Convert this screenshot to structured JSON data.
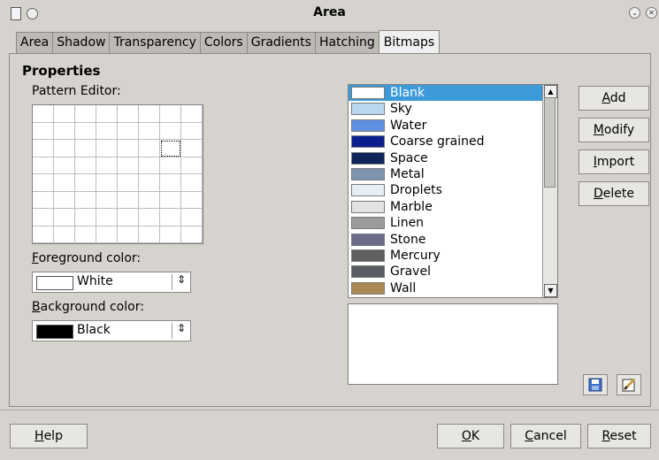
{
  "window": {
    "title": "Area"
  },
  "tabs": [
    "Area",
    "Shadow",
    "Transparency",
    "Colors",
    "Gradients",
    "Hatching",
    "Bitmaps"
  ],
  "active_tab": "Bitmaps",
  "properties": {
    "title": "Properties",
    "pattern_editor_label": "Pattern Editor:",
    "foreground_label_key": "F",
    "foreground_label_rest": "oreground color:",
    "foreground_value": "White",
    "background_label_key": "B",
    "background_label_rest": "ackground color:",
    "background_value": "Black"
  },
  "bitmaps": [
    {
      "label": "Blank",
      "swatch": "#ffffff"
    },
    {
      "label": "Sky",
      "swatch": "#b9d7f0"
    },
    {
      "label": "Water",
      "swatch": "#5f8fe0"
    },
    {
      "label": "Coarse grained",
      "swatch": "#0b1f8f"
    },
    {
      "label": "Space",
      "swatch": "#10245a"
    },
    {
      "label": "Metal",
      "swatch": "#7e93b0"
    },
    {
      "label": "Droplets",
      "swatch": "#e7eef6"
    },
    {
      "label": "Marble",
      "swatch": "#e3e3e3"
    },
    {
      "label": "Linen",
      "swatch": "#9b9b9b"
    },
    {
      "label": "Stone",
      "swatch": "#6d6b8a"
    },
    {
      "label": "Mercury",
      "swatch": "#5f6062"
    },
    {
      "label": "Gravel",
      "swatch": "#5a5d63"
    },
    {
      "label": "Wall",
      "swatch": "#a98a55"
    }
  ],
  "buttons": {
    "add_key": "A",
    "add_rest": "dd",
    "modify_key": "M",
    "modify_rest": "odify",
    "import_key": "I",
    "import_rest": "mport",
    "delete_key": "D",
    "delete_rest": "elete",
    "help_key": "H",
    "help_rest": "elp",
    "ok_key": "O",
    "ok_rest": "K",
    "cancel_pre": "",
    "cancel_key": "C",
    "cancel_rest": "ancel",
    "reset_key": "R",
    "reset_rest": "eset"
  }
}
